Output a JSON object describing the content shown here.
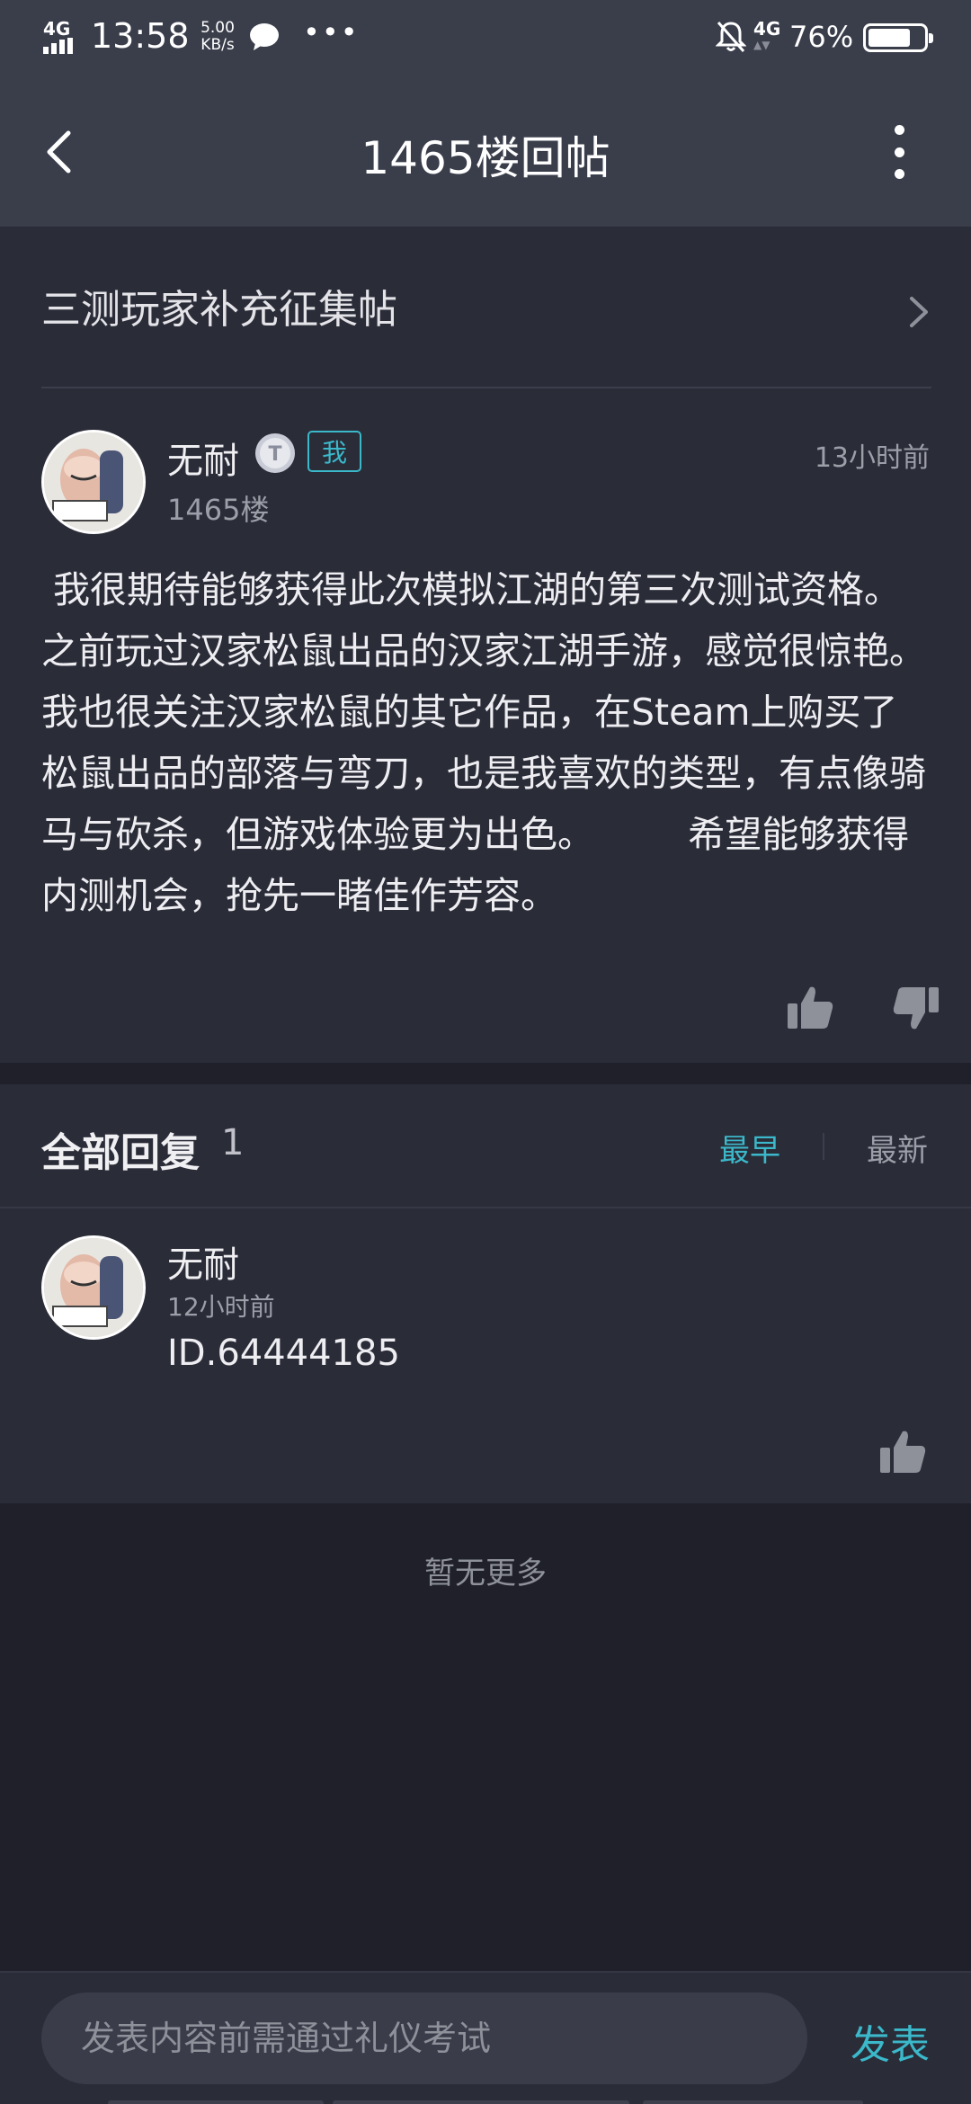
{
  "status_bar": {
    "network": "4G",
    "time": "13:58",
    "speed_value": "5.00",
    "speed_unit": "KB/s",
    "dots": "•••",
    "network2": "4G",
    "battery_pct": "76%",
    "battery_level": 0.76,
    "icons": [
      "signal-icon",
      "wechat-bubble-icon",
      "mute-bell-icon",
      "battery-icon"
    ]
  },
  "header": {
    "title": "1465楼回帖"
  },
  "thread": {
    "title": "三测玩家补充征集帖"
  },
  "post": {
    "author": "无耐",
    "badge_me": "我",
    "time": "13小时前",
    "floor": "1465楼",
    "body": " 我很期待能够获得此次模拟江湖的第三次测试资格。之前玩过汉家松鼠出品的汉家江湖手游，感觉很惊艳。我也很关注汉家松鼠的其它作品，在Steam上购买了松鼠出品的部落与弯刀，也是我喜欢的类型，有点像骑马与砍杀，但游戏体验更为出色。        希望能够获得内测机会，抢先一睹佳作芳容。"
  },
  "replies": {
    "title": "全部回复",
    "count": "1",
    "sort_earliest": "最早",
    "sort_latest": "最新",
    "items": [
      {
        "author": "无耐",
        "time": "12小时前",
        "body": "ID.64444185"
      }
    ],
    "end_text": "暂无更多"
  },
  "composer": {
    "placeholder": "发表内容前需通过礼仪考试",
    "send_label": "发表"
  },
  "colors": {
    "accent": "#3bb8c9",
    "background": "#1f2029",
    "panel": "#2a2c38",
    "header": "#3a3e4b"
  }
}
